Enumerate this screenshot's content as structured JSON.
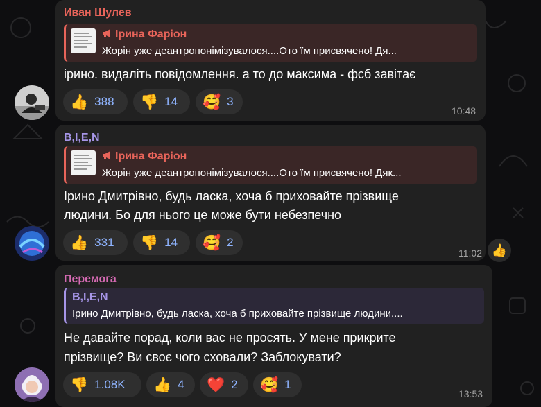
{
  "messages": [
    {
      "sender": "Иван Шулев",
      "sender_color": "#e8645a",
      "quote": {
        "title": "Ірина Фаріон",
        "text": "Жорін уже деантропонімізувалося....Ото їм присвячено! Дя..."
      },
      "body": "ірино. видаліть повідомлення. а то до максима - фсб завітає",
      "reactions": [
        {
          "icon": "thumbs-up",
          "glyph": "👍",
          "count": "388"
        },
        {
          "icon": "thumbs-down",
          "glyph": "👎",
          "count": "14"
        },
        {
          "icon": "smiling-face-with-hearts",
          "glyph": "🥰",
          "count": "3"
        }
      ],
      "time": "10:48"
    },
    {
      "sender": "B,I,E,N",
      "sender_color": "#a695e7",
      "quote": {
        "title": "Ірина Фаріон",
        "text": "Жорін уже деантропонімізувалося....Ото їм присвячено! Дяк..."
      },
      "body_lines": [
        "Ірино Дмитрівно,  будь ласка, хоча б приховайте  прізвище",
        "людини.  Бо для нього це може бути небезпечно"
      ],
      "reactions": [
        {
          "icon": "thumbs-up",
          "glyph": "👍",
          "count": "331"
        },
        {
          "icon": "thumbs-down",
          "glyph": "👎",
          "count": "14"
        },
        {
          "icon": "smiling-face-with-hearts",
          "glyph": "🥰",
          "count": "2"
        }
      ],
      "time": "11:02",
      "side_reaction": "👍"
    },
    {
      "sender": "Перемога",
      "sender_color": "#d56ab3",
      "quote": {
        "title": "B,I,E,N",
        "text": "Ірино Дмитрівно, будь ласка, хоча б приховайте прізвище людини...."
      },
      "body_lines": [
        "Не давайте порад, коли вас не просять. У мене прикрите",
        "прізвище? Ви своє чого сховали? Заблокувати?"
      ],
      "reactions": [
        {
          "icon": "thumbs-down",
          "glyph": "👎",
          "count": "1.08K"
        },
        {
          "icon": "thumbs-up",
          "glyph": "👍",
          "count": "4"
        },
        {
          "icon": "red-heart",
          "glyph": "❤️",
          "count": "2"
        },
        {
          "icon": "smiling-face-with-hearts",
          "glyph": "🥰",
          "count": "1"
        }
      ],
      "time": "13:53"
    }
  ]
}
